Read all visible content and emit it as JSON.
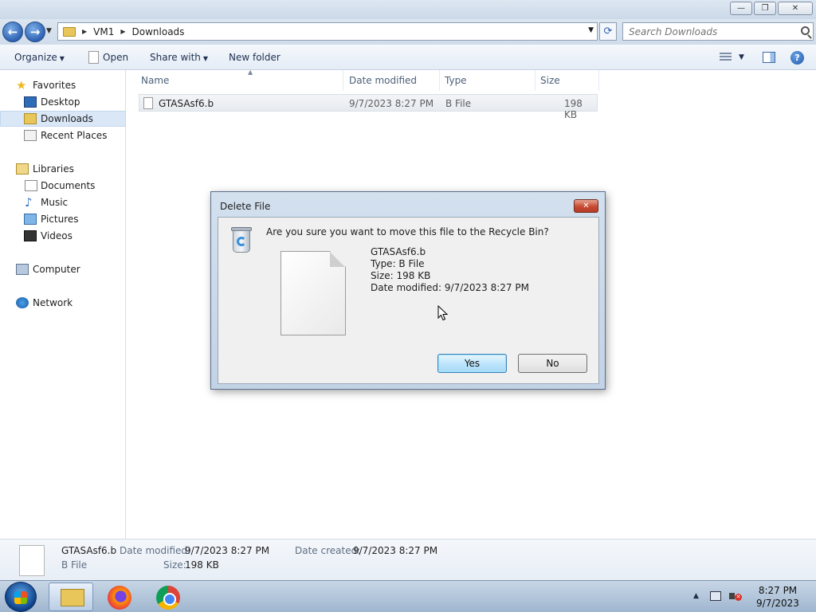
{
  "titlebar": {
    "minimize_glyph": "—",
    "maximize_glyph": "❐",
    "close_glyph": "✕"
  },
  "address": {
    "back_glyph": "←",
    "forward_glyph": "→",
    "breadcrumb": [
      "VM1",
      "Downloads"
    ],
    "refresh_glyph": "⟳",
    "search_placeholder": "Search Downloads"
  },
  "toolbar": {
    "organize": "Organize",
    "open": "Open",
    "share_with": "Share with",
    "new_folder": "New folder",
    "help_glyph": "?"
  },
  "sidebar": {
    "favorites": "Favorites",
    "desktop": "Desktop",
    "downloads": "Downloads",
    "recent_places": "Recent Places",
    "libraries": "Libraries",
    "documents": "Documents",
    "music": "Music",
    "pictures": "Pictures",
    "videos": "Videos",
    "computer": "Computer",
    "network": "Network"
  },
  "columns": {
    "name": "Name",
    "date_modified": "Date modified",
    "type": "Type",
    "size": "Size"
  },
  "files": [
    {
      "name": "GTASAsf6.b",
      "date_modified": "9/7/2023 8:27 PM",
      "type": "B File",
      "size": "198 KB"
    }
  ],
  "details": {
    "name": "GTASAsf6.b",
    "type": "B File",
    "date_modified_label": "Date modified:",
    "date_modified": "9/7/2023 8:27 PM",
    "date_created_label": "Date created:",
    "date_created": "9/7/2023 8:27 PM",
    "size_label": "Size:",
    "size": "198 KB"
  },
  "dialog": {
    "title": "Delete File",
    "close_glyph": "✕",
    "question": "Are you sure you want to move this file to the Recycle Bin?",
    "file_name": "GTASAsf6.b",
    "file_type": "Type: B File",
    "file_size": "Size: 198 KB",
    "file_date": "Date modified: 9/7/2023 8:27 PM",
    "yes": "Yes",
    "no": "No"
  },
  "taskbar": {
    "time": "8:27 PM",
    "date": "9/7/2023",
    "tray_expand_glyph": "▲",
    "volume_muted_glyph": "✕"
  },
  "icons": {
    "favorites": "star-icon",
    "recycle_bin": "recycle-bin-icon",
    "file": "blank-file-icon"
  }
}
